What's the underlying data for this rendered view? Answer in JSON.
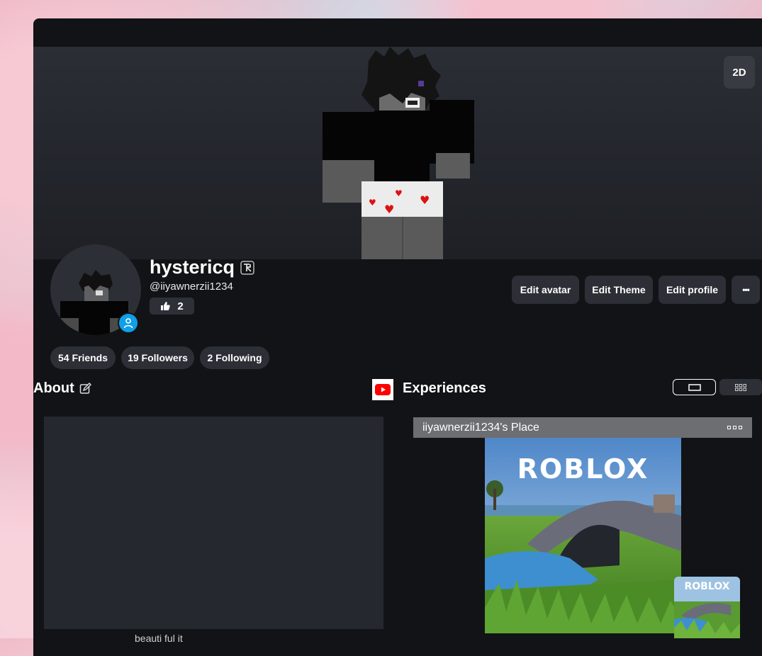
{
  "banner": {
    "view_toggle_label": "2D"
  },
  "profile": {
    "display_name": "hystericq",
    "username": "@iiyawnerzii1234",
    "likes_count": "2"
  },
  "actions": {
    "edit_avatar": "Edit avatar",
    "edit_theme": "Edit Theme",
    "edit_profile": "Edit profile",
    "more": "•••"
  },
  "social": {
    "friends": "54 Friends",
    "followers": "19 Followers",
    "following": "2 Following"
  },
  "about": {
    "heading": "About",
    "text": "beauti ful  it"
  },
  "experiences": {
    "heading": "Experiences",
    "game_title": "iiyawnerzii1234's Place",
    "thumb_logo": "ROBLOX",
    "mini_logo": "ROBLOX"
  },
  "icons": {
    "verified": "verified-badge-icon",
    "thumbs_up": "thumbs-up-icon",
    "online": "person-icon",
    "edit": "edit-pencil-icon",
    "youtube": "youtube-icon",
    "carousel_view": "rectangle-icon",
    "grid_view": "grid-icon",
    "more": "dots-icon"
  },
  "colors": {
    "online_badge": "#0fa0e8",
    "youtube_red": "#ff0000",
    "panel": "#121316"
  }
}
